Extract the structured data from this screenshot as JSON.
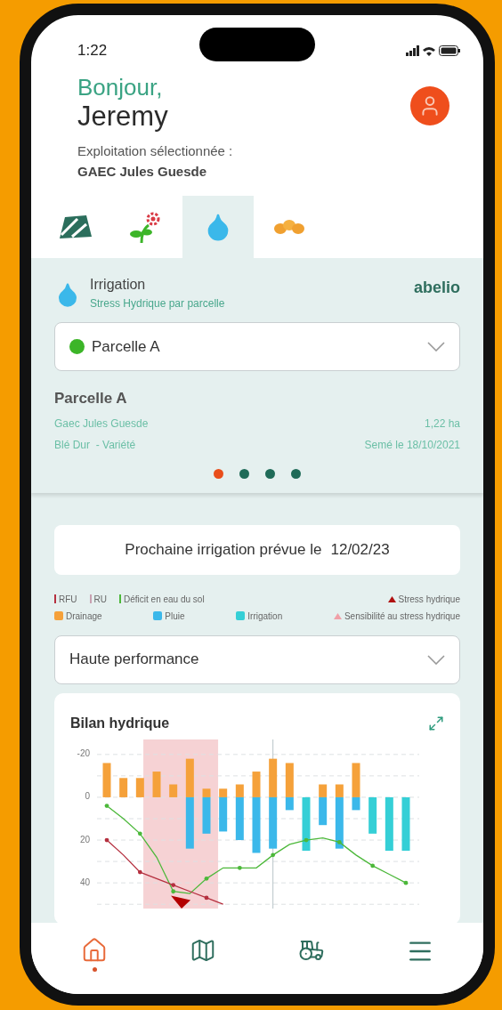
{
  "status_bar": {
    "time": "1:22"
  },
  "greeting": {
    "hello": "Bonjour,",
    "name": "Jeremy",
    "farm_label": "Exploitation sélectionnée :",
    "farm": "GAEC Jules Guesde"
  },
  "tabs": [
    {
      "kind": "parcels",
      "selected": false
    },
    {
      "kind": "crops",
      "selected": false
    },
    {
      "kind": "water",
      "selected": true
    },
    {
      "kind": "seeds",
      "selected": false
    }
  ],
  "module": {
    "title": "Irrigation",
    "subtitle": "Stress Hydrique par parcelle",
    "brand": "abelio"
  },
  "parcel_select": {
    "value": "Parcelle A",
    "color": "#3cb528"
  },
  "parcel": {
    "name": "Parcelle A",
    "farm": "Gaec Jules Guesde",
    "area": "1,22 ha",
    "crop": "Blé Dur  - Variété",
    "sown": "Semé le 18/10/2021"
  },
  "pages": [
    {
      "selected": true
    },
    {
      "selected": false
    },
    {
      "selected": false
    },
    {
      "selected": false
    }
  ],
  "next_irrigation": {
    "label": "Prochaine irrigation prévue le",
    "date": "12/02/23"
  },
  "legend": [
    {
      "items": [
        {
          "kind": "bar",
          "label": "RU",
          "color": "#c8a0b0"
        },
        {
          "kind": "triangle",
          "label": "Stress hydrique",
          "color": "#b01010"
        }
      ]
    },
    {
      "items": [
        {
          "kind": "triangle",
          "label": "Sensibilité au stress hydrique",
          "color": "#f0a0a8"
        }
      ]
    }
  ],
  "mode_select": {
    "value": "Haute performance"
  },
  "chart": {
    "title": "Bilan hydrique",
    "chart_data": {
      "type": "bar",
      "stacked": true,
      "grid": true,
      "categories": [
        null,
        null,
        null,
        null,
        null,
        null,
        null,
        null,
        null,
        null,
        null,
        null,
        null,
        null,
        null,
        null,
        null,
        null,
        null
      ],
      "ylim": [
        52,
        -27
      ],
      "yticks": [
        -20,
        0,
        20,
        40
      ],
      "series": [
        {
          "name": "Drainage",
          "color": "#f5a13a",
          "values": [
            -16,
            -9,
            -9,
            -12,
            -6,
            -18,
            -4,
            -4,
            -6,
            -12,
            -18,
            -16,
            0,
            -6,
            -6,
            -16,
            0,
            0,
            0
          ]
        },
        {
          "name": "Pluie",
          "color": "#3bb8ea",
          "values": [
            0,
            0,
            0,
            0,
            0,
            24,
            17,
            16,
            20,
            26,
            24,
            6,
            0,
            13,
            24,
            6,
            0,
            0,
            0
          ]
        },
        {
          "name": "Irrigation",
          "color": "#35cfd6",
          "values": [
            0,
            0,
            0,
            0,
            0,
            0,
            0,
            0,
            0,
            0,
            0,
            0,
            25,
            0,
            0,
            0,
            17,
            25,
            25
          ]
        },
        {
          "name": "Déficit en eau du sol",
          "type": "line",
          "color": "#4cb83a",
          "values": [
            4,
            10,
            17,
            28,
            44,
            45,
            38,
            33,
            33,
            33,
            27,
            22,
            20,
            19,
            21,
            27,
            32,
            36,
            40
          ]
        },
        {
          "name": "RFU",
          "type": "line",
          "color": "#b5303f",
          "values": [
            20,
            27,
            35,
            38,
            41,
            44,
            47,
            50,
            null,
            null,
            null,
            null,
            null,
            null,
            null,
            null,
            null,
            null,
            null
          ]
        }
      ]
    }
  },
  "nav": [
    {
      "kind": "home",
      "selected": true
    },
    {
      "kind": "map",
      "selected": false
    },
    {
      "kind": "tractor",
      "selected": false
    },
    {
      "kind": "menu",
      "selected": false
    }
  ]
}
